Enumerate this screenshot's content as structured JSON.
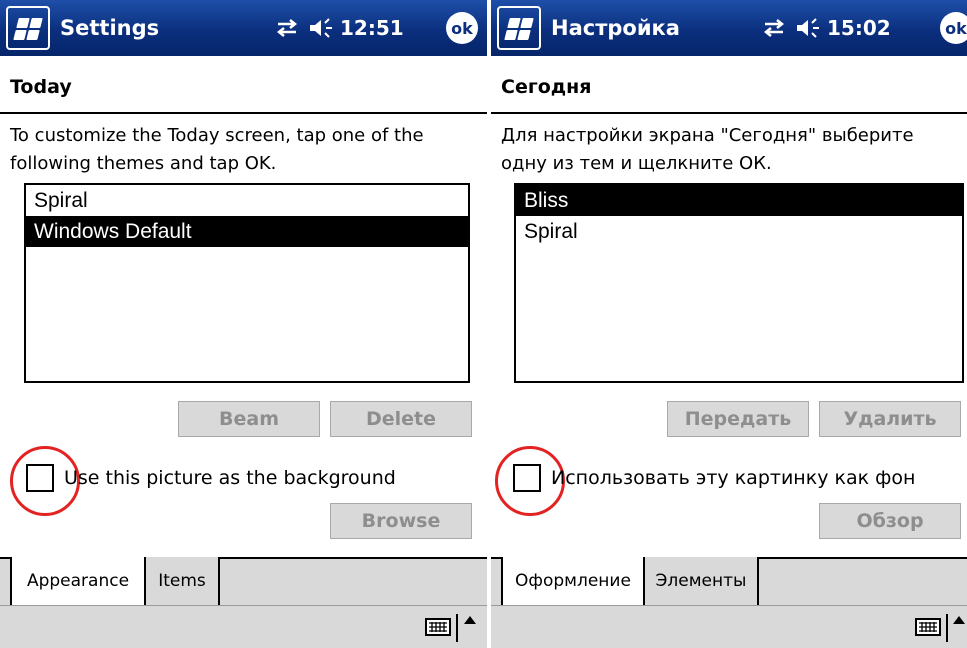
{
  "screens": [
    {
      "app_title": "Settings",
      "clock": "12:51",
      "ok_label": "ok",
      "heading": "Today",
      "instructions": "To customize the Today screen, tap one of the following themes and tap OK.",
      "themes": [
        {
          "label": "Spiral",
          "selected": false
        },
        {
          "label": "Windows Default",
          "selected": true
        }
      ],
      "beam_label": "Beam",
      "delete_label": "Delete",
      "checkbox_label": "Use this picture as the background",
      "checkbox_checked": false,
      "browse_label": "Browse",
      "tabs": [
        {
          "label": "Appearance",
          "active": true
        },
        {
          "label": "Items",
          "active": false
        }
      ]
    },
    {
      "app_title": "Настройка",
      "clock": "15:02",
      "ok_label": "ok",
      "heading": "Сегодня",
      "instructions": "Для настройки экрана \"Сегодня\" выберите одну из тем и щелкните ОК.",
      "themes": [
        {
          "label": "Bliss",
          "selected": true
        },
        {
          "label": "Spiral",
          "selected": false
        }
      ],
      "beam_label": "Передать",
      "delete_label": "Удалить",
      "checkbox_label": "Использовать эту картинку как фон",
      "checkbox_checked": false,
      "browse_label": "Обзор",
      "tabs": [
        {
          "label": "Оформление",
          "active": true
        },
        {
          "label": "Элементы",
          "active": false
        }
      ]
    }
  ],
  "icons": {
    "start": "windows-flag-icon",
    "connectivity": "connectivity-arrows-icon",
    "volume": "speaker-volume-icon",
    "keyboard": "keyboard-icon",
    "sip_toggle": "up-arrow-icon"
  },
  "colors": {
    "titlebar": "#0b2f7e",
    "selection": "#000000",
    "disabled_button": "#d9d9d9",
    "callout": "#e32222"
  }
}
